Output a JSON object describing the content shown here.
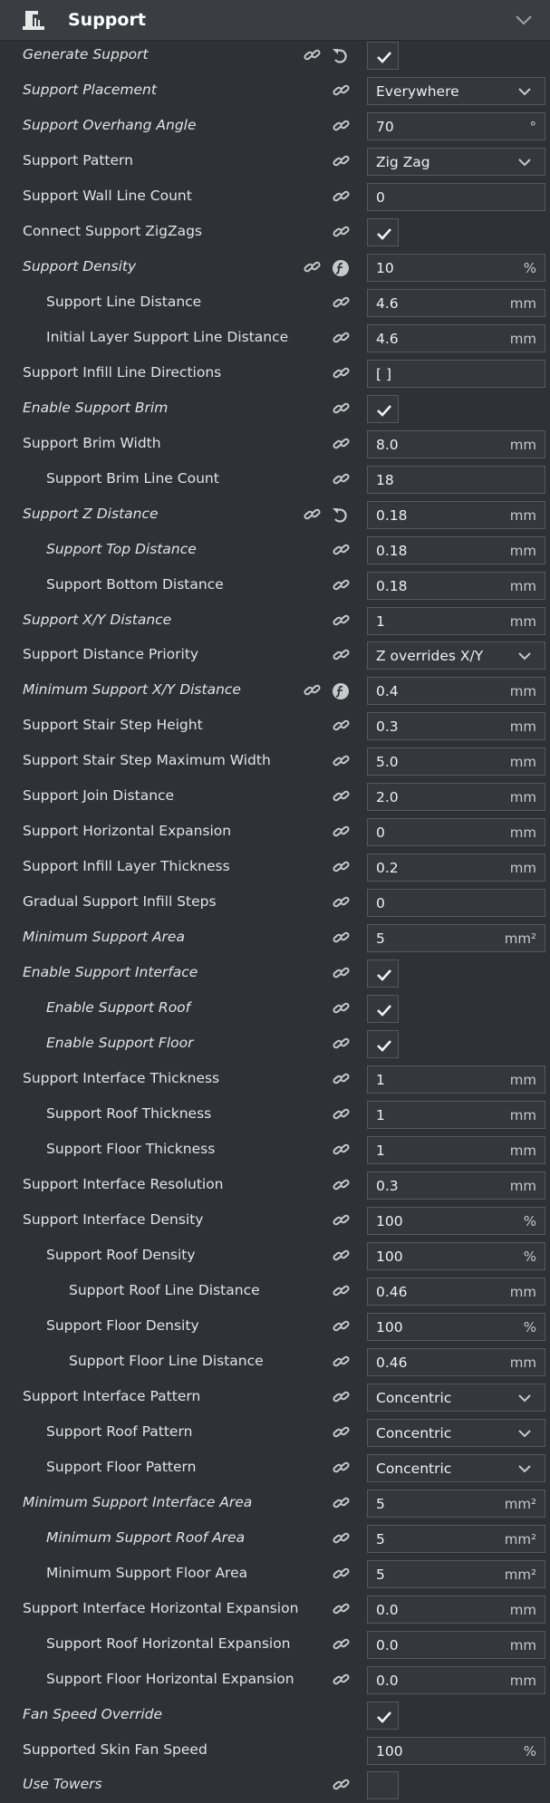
{
  "header": {
    "title": "Support",
    "icon": "support-category-icon"
  },
  "rows": [
    {
      "label": "Generate Support",
      "italic": true,
      "indent": 0,
      "type": "check",
      "checked": true,
      "extra": "reset"
    },
    {
      "label": "Support Placement",
      "italic": true,
      "indent": 0,
      "type": "select",
      "value": "Everywhere"
    },
    {
      "label": "Support Overhang Angle",
      "italic": true,
      "indent": 0,
      "type": "input",
      "value": "70",
      "unit": "°"
    },
    {
      "label": "Support Pattern",
      "italic": false,
      "indent": 0,
      "type": "select",
      "value": "Zig Zag"
    },
    {
      "label": "Support Wall Line Count",
      "italic": false,
      "indent": 0,
      "type": "input",
      "value": "0",
      "unit": ""
    },
    {
      "label": "Connect Support ZigZags",
      "italic": false,
      "indent": 0,
      "type": "check",
      "checked": true
    },
    {
      "label": "Support Density",
      "italic": true,
      "indent": 0,
      "type": "input",
      "value": "10",
      "unit": "%",
      "extra": "function"
    },
    {
      "label": "Support Line Distance",
      "italic": false,
      "indent": 1,
      "type": "input",
      "value": "4.6",
      "unit": "mm"
    },
    {
      "label": "Initial Layer Support Line Distance",
      "italic": false,
      "indent": 1,
      "type": "input",
      "value": "4.6",
      "unit": "mm"
    },
    {
      "label": "Support Infill Line Directions",
      "italic": false,
      "indent": 0,
      "type": "input",
      "value": "[ ]",
      "unit": ""
    },
    {
      "label": "Enable Support Brim",
      "italic": true,
      "indent": 0,
      "type": "check",
      "checked": true
    },
    {
      "label": "Support Brim Width",
      "italic": false,
      "indent": 0,
      "type": "input",
      "value": "8.0",
      "unit": "mm"
    },
    {
      "label": "Support Brim Line Count",
      "italic": false,
      "indent": 1,
      "type": "input",
      "value": "18",
      "unit": ""
    },
    {
      "label": "Support Z Distance",
      "italic": true,
      "indent": 0,
      "type": "input",
      "value": "0.18",
      "unit": "mm",
      "extra": "reset"
    },
    {
      "label": "Support Top Distance",
      "italic": true,
      "indent": 1,
      "type": "input",
      "value": "0.18",
      "unit": "mm"
    },
    {
      "label": "Support Bottom Distance",
      "italic": false,
      "indent": 1,
      "type": "input",
      "value": "0.18",
      "unit": "mm"
    },
    {
      "label": "Support X/Y Distance",
      "italic": true,
      "indent": 0,
      "type": "input",
      "value": "1",
      "unit": "mm"
    },
    {
      "label": "Support Distance Priority",
      "italic": false,
      "indent": 0,
      "type": "select",
      "value": "Z overrides X/Y"
    },
    {
      "label": "Minimum Support X/Y Distance",
      "italic": true,
      "indent": 0,
      "type": "input",
      "value": "0.4",
      "unit": "mm",
      "extra": "function"
    },
    {
      "label": "Support Stair Step Height",
      "italic": false,
      "indent": 0,
      "type": "input",
      "value": "0.3",
      "unit": "mm"
    },
    {
      "label": "Support Stair Step Maximum Width",
      "italic": false,
      "indent": 0,
      "type": "input",
      "value": "5.0",
      "unit": "mm"
    },
    {
      "label": "Support Join Distance",
      "italic": false,
      "indent": 0,
      "type": "input",
      "value": "2.0",
      "unit": "mm"
    },
    {
      "label": "Support Horizontal Expansion",
      "italic": false,
      "indent": 0,
      "type": "input",
      "value": "0",
      "unit": "mm"
    },
    {
      "label": "Support Infill Layer Thickness",
      "italic": false,
      "indent": 0,
      "type": "input",
      "value": "0.2",
      "unit": "mm"
    },
    {
      "label": "Gradual Support Infill Steps",
      "italic": false,
      "indent": 0,
      "type": "input",
      "value": "0",
      "unit": ""
    },
    {
      "label": "Minimum Support Area",
      "italic": true,
      "indent": 0,
      "type": "input",
      "value": "5",
      "unit": "mm²"
    },
    {
      "label": "Enable Support Interface",
      "italic": true,
      "indent": 0,
      "type": "check",
      "checked": true
    },
    {
      "label": "Enable Support Roof",
      "italic": true,
      "indent": 1,
      "type": "check",
      "checked": true
    },
    {
      "label": "Enable Support Floor",
      "italic": true,
      "indent": 1,
      "type": "check",
      "checked": true
    },
    {
      "label": "Support Interface Thickness",
      "italic": false,
      "indent": 0,
      "type": "input",
      "value": "1",
      "unit": "mm"
    },
    {
      "label": "Support Roof Thickness",
      "italic": false,
      "indent": 1,
      "type": "input",
      "value": "1",
      "unit": "mm"
    },
    {
      "label": "Support Floor Thickness",
      "italic": false,
      "indent": 1,
      "type": "input",
      "value": "1",
      "unit": "mm"
    },
    {
      "label": "Support Interface Resolution",
      "italic": false,
      "indent": 0,
      "type": "input",
      "value": "0.3",
      "unit": "mm"
    },
    {
      "label": "Support Interface Density",
      "italic": false,
      "indent": 0,
      "type": "input",
      "value": "100",
      "unit": "%"
    },
    {
      "label": "Support Roof Density",
      "italic": false,
      "indent": 1,
      "type": "input",
      "value": "100",
      "unit": "%"
    },
    {
      "label": "Support Roof Line Distance",
      "italic": false,
      "indent": 2,
      "type": "input",
      "value": "0.46",
      "unit": "mm"
    },
    {
      "label": "Support Floor Density",
      "italic": false,
      "indent": 1,
      "type": "input",
      "value": "100",
      "unit": "%"
    },
    {
      "label": "Support Floor Line Distance",
      "italic": false,
      "indent": 2,
      "type": "input",
      "value": "0.46",
      "unit": "mm"
    },
    {
      "label": "Support Interface Pattern",
      "italic": false,
      "indent": 0,
      "type": "select",
      "value": "Concentric"
    },
    {
      "label": "Support Roof Pattern",
      "italic": false,
      "indent": 1,
      "type": "select",
      "value": "Concentric"
    },
    {
      "label": "Support Floor Pattern",
      "italic": false,
      "indent": 1,
      "type": "select",
      "value": "Concentric"
    },
    {
      "label": "Minimum Support Interface Area",
      "italic": true,
      "indent": 0,
      "type": "input",
      "value": "5",
      "unit": "mm²"
    },
    {
      "label": "Minimum Support Roof Area",
      "italic": true,
      "indent": 1,
      "type": "input",
      "value": "5",
      "unit": "mm²"
    },
    {
      "label": "Minimum Support Floor Area",
      "italic": false,
      "indent": 1,
      "type": "input",
      "value": "5",
      "unit": "mm²"
    },
    {
      "label": "Support Interface Horizontal Expansion",
      "italic": false,
      "indent": 0,
      "type": "input",
      "value": "0.0",
      "unit": "mm"
    },
    {
      "label": "Support Roof Horizontal Expansion",
      "italic": false,
      "indent": 1,
      "type": "input",
      "value": "0.0",
      "unit": "mm"
    },
    {
      "label": "Support Floor Horizontal Expansion",
      "italic": false,
      "indent": 1,
      "type": "input",
      "value": "0.0",
      "unit": "mm"
    },
    {
      "label": "Fan Speed Override",
      "italic": true,
      "indent": 0,
      "type": "check",
      "checked": true,
      "nolink": true
    },
    {
      "label": "Supported Skin Fan Speed",
      "italic": false,
      "indent": 0,
      "type": "input",
      "value": "100",
      "unit": "%",
      "nolink": true
    },
    {
      "label": "Use Towers",
      "italic": true,
      "indent": 0,
      "type": "check",
      "checked": false
    }
  ]
}
